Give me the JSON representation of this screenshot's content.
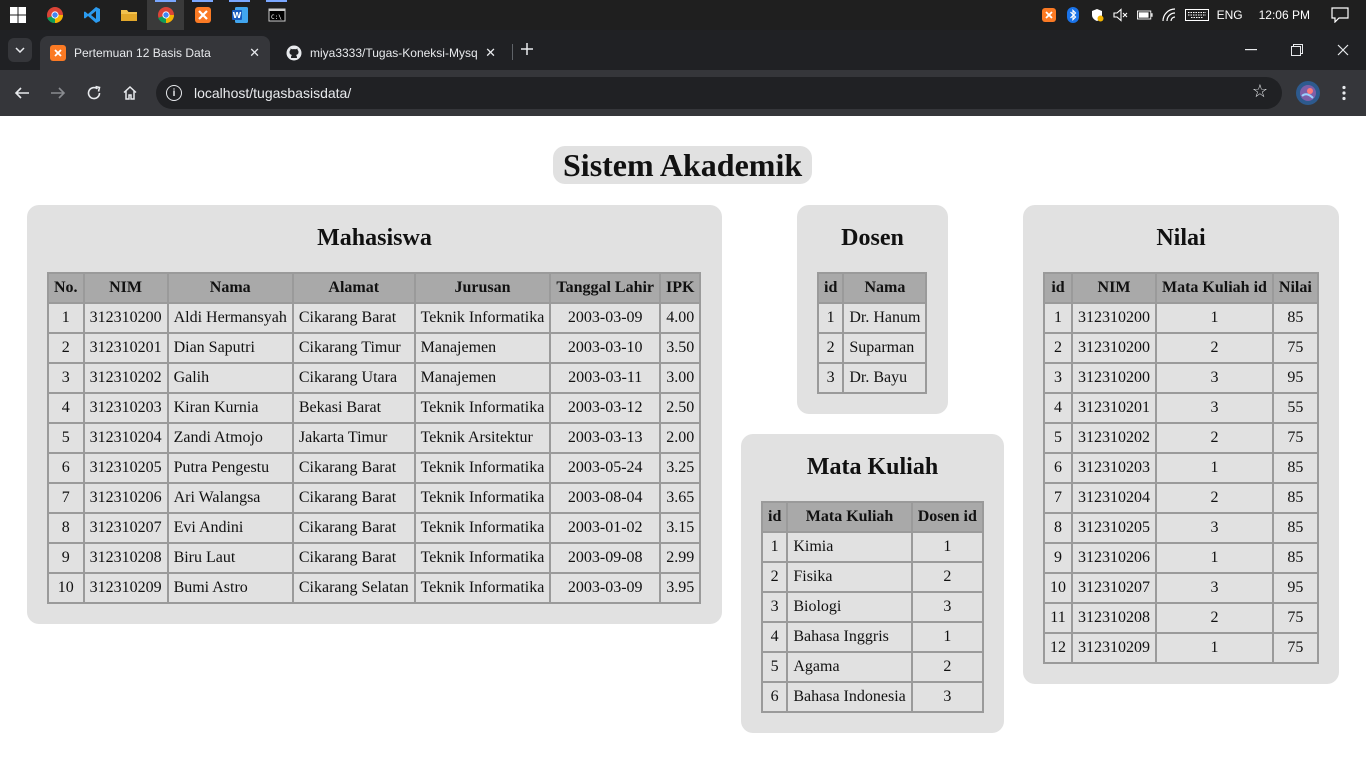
{
  "taskbar": {
    "apps": [
      "start-icon",
      "chrome-icon",
      "vscode-icon",
      "file-explorer-icon",
      "chrome-active-icon",
      "xampp-icon",
      "word-icon",
      "terminal-icon"
    ],
    "tray": {
      "language": "ENG",
      "time": "12:06 PM"
    }
  },
  "browser": {
    "tabs": [
      {
        "title": "Pertemuan 12 Basis Data",
        "active": true
      },
      {
        "title": "miya3333/Tugas-Koneksi-Mysq",
        "active": false
      }
    ],
    "url": "localhost/tugasbasisdata/"
  },
  "page": {
    "title": "Sistem Akademik",
    "mahasiswa": {
      "title": "Mahasiswa",
      "headers": [
        "No.",
        "NIM",
        "Nama",
        "Alamat",
        "Jurusan",
        "Tanggal Lahir",
        "IPK"
      ],
      "rows": [
        [
          "1",
          "312310200",
          "Aldi Hermansyah",
          "Cikarang Barat",
          "Teknik Informatika",
          "2003-03-09",
          "4.00"
        ],
        [
          "2",
          "312310201",
          "Dian Saputri",
          "Cikarang Timur",
          "Manajemen",
          "2003-03-10",
          "3.50"
        ],
        [
          "3",
          "312310202",
          "Galih",
          "Cikarang Utara",
          "Manajemen",
          "2003-03-11",
          "3.00"
        ],
        [
          "4",
          "312310203",
          "Kiran Kurnia",
          "Bekasi Barat",
          "Teknik Informatika",
          "2003-03-12",
          "2.50"
        ],
        [
          "5",
          "312310204",
          "Zandi Atmojo",
          "Jakarta Timur",
          "Teknik Arsitektur",
          "2003-03-13",
          "2.00"
        ],
        [
          "6",
          "312310205",
          "Putra Pengestu",
          "Cikarang Barat",
          "Teknik Informatika",
          "2003-05-24",
          "3.25"
        ],
        [
          "7",
          "312310206",
          "Ari Walangsa",
          "Cikarang Barat",
          "Teknik Informatika",
          "2003-08-04",
          "3.65"
        ],
        [
          "8",
          "312310207",
          "Evi Andini",
          "Cikarang Barat",
          "Teknik Informatika",
          "2003-01-02",
          "3.15"
        ],
        [
          "9",
          "312310208",
          "Biru Laut",
          "Cikarang Barat",
          "Teknik Informatika",
          "2003-09-08",
          "2.99"
        ],
        [
          "10",
          "312310209",
          "Bumi Astro",
          "Cikarang Selatan",
          "Teknik Informatika",
          "2003-03-09",
          "3.95"
        ]
      ]
    },
    "dosen": {
      "title": "Dosen",
      "headers": [
        "id",
        "Nama"
      ],
      "rows": [
        [
          "1",
          "Dr. Hanum"
        ],
        [
          "2",
          "Suparman"
        ],
        [
          "3",
          "Dr. Bayu"
        ]
      ]
    },
    "mata_kuliah": {
      "title": "Mata Kuliah",
      "headers": [
        "id",
        "Mata Kuliah",
        "Dosen id"
      ],
      "rows": [
        [
          "1",
          "Kimia",
          "1"
        ],
        [
          "2",
          "Fisika",
          "2"
        ],
        [
          "3",
          "Biologi",
          "3"
        ],
        [
          "4",
          "Bahasa Inggris",
          "1"
        ],
        [
          "5",
          "Agama",
          "2"
        ],
        [
          "6",
          "Bahasa Indonesia",
          "3"
        ]
      ]
    },
    "nilai": {
      "title": "Nilai",
      "headers": [
        "id",
        "NIM",
        "Mata Kuliah id",
        "Nilai"
      ],
      "rows": [
        [
          "1",
          "312310200",
          "1",
          "85"
        ],
        [
          "2",
          "312310200",
          "2",
          "75"
        ],
        [
          "3",
          "312310200",
          "3",
          "95"
        ],
        [
          "4",
          "312310201",
          "3",
          "55"
        ],
        [
          "5",
          "312310202",
          "2",
          "75"
        ],
        [
          "6",
          "312310203",
          "1",
          "85"
        ],
        [
          "7",
          "312310204",
          "2",
          "85"
        ],
        [
          "8",
          "312310205",
          "3",
          "85"
        ],
        [
          "9",
          "312310206",
          "1",
          "85"
        ],
        [
          "10",
          "312310207",
          "3",
          "95"
        ],
        [
          "11",
          "312310208",
          "2",
          "75"
        ],
        [
          "12",
          "312310209",
          "1",
          "75"
        ]
      ]
    }
  }
}
